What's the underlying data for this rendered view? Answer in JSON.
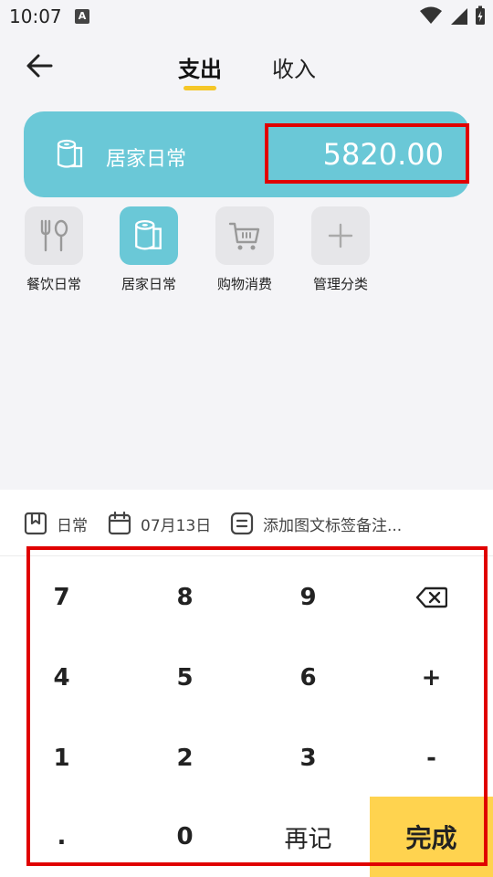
{
  "status_bar": {
    "time": "10:07",
    "notification_letter": "A"
  },
  "header": {
    "tabs": [
      {
        "label": "支出",
        "active": true
      },
      {
        "label": "收入",
        "active": false
      }
    ]
  },
  "amount_card": {
    "category": "居家日常",
    "amount": "5820.00",
    "color": "#6ac8d7"
  },
  "categories": [
    {
      "label": "餐饮日常",
      "icon": "fork-spoon-icon",
      "selected": false
    },
    {
      "label": "居家日常",
      "icon": "paper-roll-icon",
      "selected": true
    },
    {
      "label": "购物消费",
      "icon": "shopping-cart-icon",
      "selected": false
    },
    {
      "label": "管理分类",
      "icon": "plus-icon",
      "selected": false
    }
  ],
  "info_row": {
    "book": "日常",
    "date": "07月13日",
    "note_placeholder": "添加图文标签备注..."
  },
  "keypad": {
    "rows": [
      [
        "7",
        "8",
        "9",
        "⌫"
      ],
      [
        "4",
        "5",
        "6",
        "+"
      ],
      [
        "1",
        "2",
        "3",
        "-"
      ],
      [
        ".",
        "0",
        "再记",
        "完成"
      ]
    ],
    "done_color": "#ffd34f"
  },
  "accent_color": "#f5c728",
  "highlight_color": "#e00000"
}
